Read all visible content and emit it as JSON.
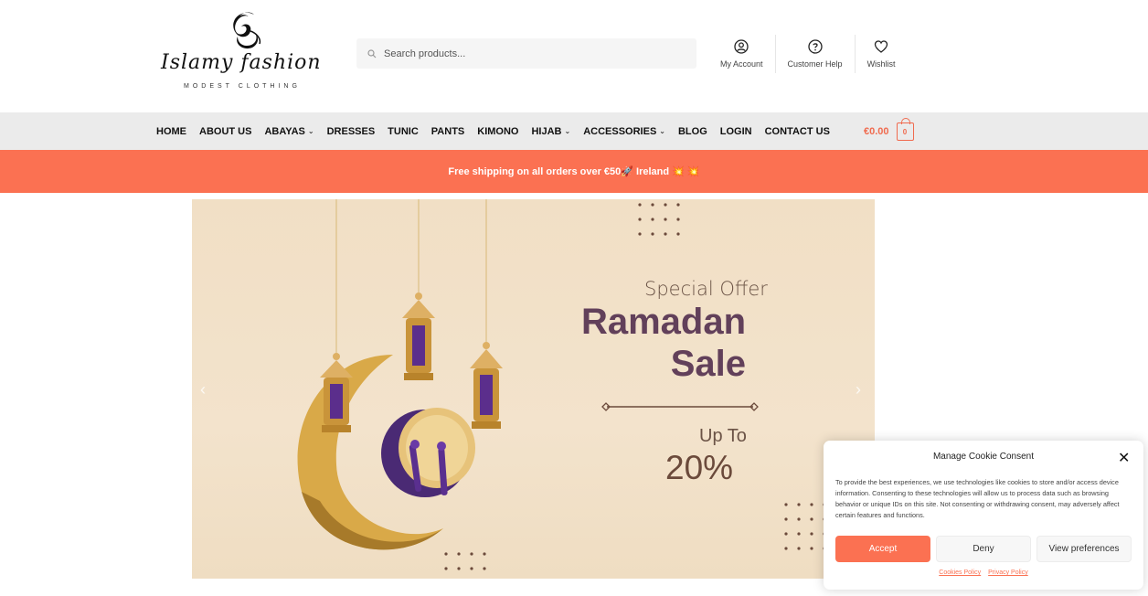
{
  "brand": {
    "name": "Islamy fashion",
    "tagline": "MODEST CLOTHING"
  },
  "search": {
    "placeholder": "Search products..."
  },
  "header_links": [
    {
      "label": "My Account",
      "icon": "user-icon"
    },
    {
      "label": "Customer Help",
      "icon": "help-icon"
    },
    {
      "label": "Wishlist",
      "icon": "heart-icon"
    }
  ],
  "nav": {
    "items": [
      {
        "label": "HOME",
        "dropdown": false
      },
      {
        "label": "ABOUT US",
        "dropdown": false
      },
      {
        "label": "ABAYAS",
        "dropdown": true
      },
      {
        "label": "DRESSES",
        "dropdown": false
      },
      {
        "label": "TUNIC",
        "dropdown": false
      },
      {
        "label": "PANTS",
        "dropdown": false
      },
      {
        "label": "KIMONO",
        "dropdown": false
      },
      {
        "label": "HIJAB",
        "dropdown": true
      },
      {
        "label": "ACCESSORIES",
        "dropdown": true
      },
      {
        "label": "BLOG",
        "dropdown": false
      },
      {
        "label": "LOGIN",
        "dropdown": false
      },
      {
        "label": "CONTACT US",
        "dropdown": false
      }
    ],
    "cart_total": "€0.00",
    "cart_count": "0"
  },
  "promo": {
    "text": "Free shipping on all orders over €50🚀 Ireland 💥 💥"
  },
  "hero": {
    "special": "Special Offer",
    "title_line1": "Ramadan",
    "title_line2": "Sale",
    "up_to": "Up To",
    "percent": "20%"
  },
  "cookie": {
    "title": "Manage Cookie Consent",
    "text": "To provide the best experiences, we use technologies like cookies to store and/or access device information. Consenting to these technologies will allow us to process data such as browsing behavior or unique IDs on this site. Not consenting or withdrawing consent, may adversely affect certain features and functions.",
    "accept": "Accept",
    "deny": "Deny",
    "preferences": "View preferences",
    "cookies_policy": "Cookies Policy",
    "privacy_policy": "Privacy Policy"
  },
  "colors": {
    "accent": "#fb7152",
    "nav_bg": "#ebebeb",
    "hero_bg": "#f1dfc5",
    "hero_title": "#62405a"
  }
}
